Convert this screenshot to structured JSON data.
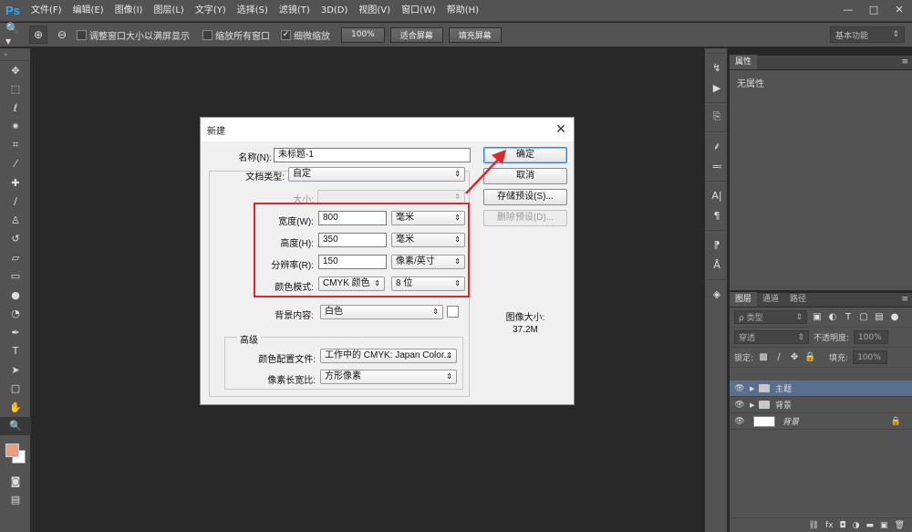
{
  "app": {
    "logo": "Ps",
    "menu": [
      "文件(F)",
      "编辑(E)",
      "图像(I)",
      "图层(L)",
      "文字(Y)",
      "选择(S)",
      "滤镜(T)",
      "3D(D)",
      "视图(V)",
      "窗口(W)",
      "帮助(H)"
    ],
    "window_controls": {
      "minimize": "—",
      "maximize": "□",
      "close": "✕"
    }
  },
  "options_bar": {
    "tool_icon": "zoom-icon",
    "resize_windows_label": "调整窗口大小以满屏显示",
    "resize_windows_checked": false,
    "zoom_all_label": "缩放所有窗口",
    "zoom_all_checked": false,
    "scrubby_zoom_label": "细微缩放",
    "scrubby_zoom_checked": true,
    "zoom_100_label": "100%",
    "fit_screen_label": "适合屏幕",
    "fill_screen_label": "填充屏幕",
    "workspace": "基本功能"
  },
  "properties_panel": {
    "tab": "属性",
    "empty_text": "无属性"
  },
  "layers_panel": {
    "tabs": [
      "图层",
      "通道",
      "路径"
    ],
    "filter_kind": "ρ 类型",
    "blend_mode": "穿透",
    "opacity_label": "不透明度:",
    "opacity_value": "100%",
    "lock_label": "锁定:",
    "fill_label": "填充:",
    "fill_value": "100%",
    "layers": [
      {
        "name": "主题",
        "type": "group",
        "selected": true
      },
      {
        "name": "背景",
        "type": "group",
        "selected": false
      },
      {
        "name": "背景",
        "type": "layer",
        "selected": false,
        "locked": true
      }
    ]
  },
  "dialog": {
    "title": "新建",
    "name_label": "名称(N):",
    "name_value": "未标题-1",
    "preset_label": "文档类型:",
    "preset_value": "自定",
    "size_label": "大小:",
    "size_value": "",
    "width_label": "宽度(W):",
    "width_value": "800",
    "width_unit": "毫米",
    "height_label": "高度(H):",
    "height_value": "350",
    "height_unit": "毫米",
    "resolution_label": "分辨率(R):",
    "resolution_value": "150",
    "resolution_unit": "像素/英寸",
    "color_mode_label": "颜色模式:",
    "color_mode_value": "CMYK 颜色",
    "bit_depth_value": "8 位",
    "background_label": "背景内容:",
    "background_value": "白色",
    "advanced_label": "高级",
    "color_profile_label": "颜色配置文件:",
    "color_profile_value": "工作中的 CMYK: Japan Color...",
    "pixel_aspect_label": "像素长宽比:",
    "pixel_aspect_value": "方形像素",
    "ok_label": "确定",
    "cancel_label": "取消",
    "save_preset_label": "存储预设(S)...",
    "delete_preset_label": "删除预设(D)...",
    "image_size_label": "图像大小:",
    "image_size_value": "37.2M"
  },
  "annotation": {
    "color": "#e0262a"
  }
}
